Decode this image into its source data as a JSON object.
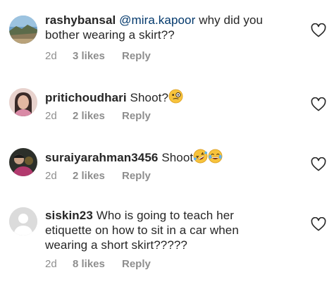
{
  "comments": [
    {
      "username": "rashybansal",
      "mention": "@mira.kapoor",
      "text_line1": " why did you",
      "text_line2": "bother wearing a skirt??",
      "age": "2d",
      "likes": "3 likes",
      "reply": "Reply",
      "avatar": "landscape-avatar"
    },
    {
      "username": "pritichoudhari",
      "text": "Shoot?",
      "emoji": [
        "face-with-monocle"
      ],
      "age": "2d",
      "likes": "2 likes",
      "reply": "Reply",
      "avatar": "woman-portrait-avatar"
    },
    {
      "username": "suraiyarahman3456",
      "text": "Shoot",
      "emoji": [
        "rolling-on-floor-laughing",
        "face-with-tears-of-joy"
      ],
      "age": "2d",
      "likes": "2 likes",
      "reply": "Reply",
      "avatar": "dark-portrait-avatar"
    },
    {
      "username": "siskin23",
      "text_line1": " Who is going to teach her",
      "text_line2": "etiquette on how to sit in a car when",
      "text_line3": "wearing a short skirt?????",
      "age": "2d",
      "likes": "8 likes",
      "reply": "Reply",
      "avatar": "default-avatar"
    }
  ],
  "colors": {
    "text": "#262626",
    "meta": "#8e8e8e",
    "mention": "#00376b",
    "emoji_yellow": "#f7c33c"
  }
}
